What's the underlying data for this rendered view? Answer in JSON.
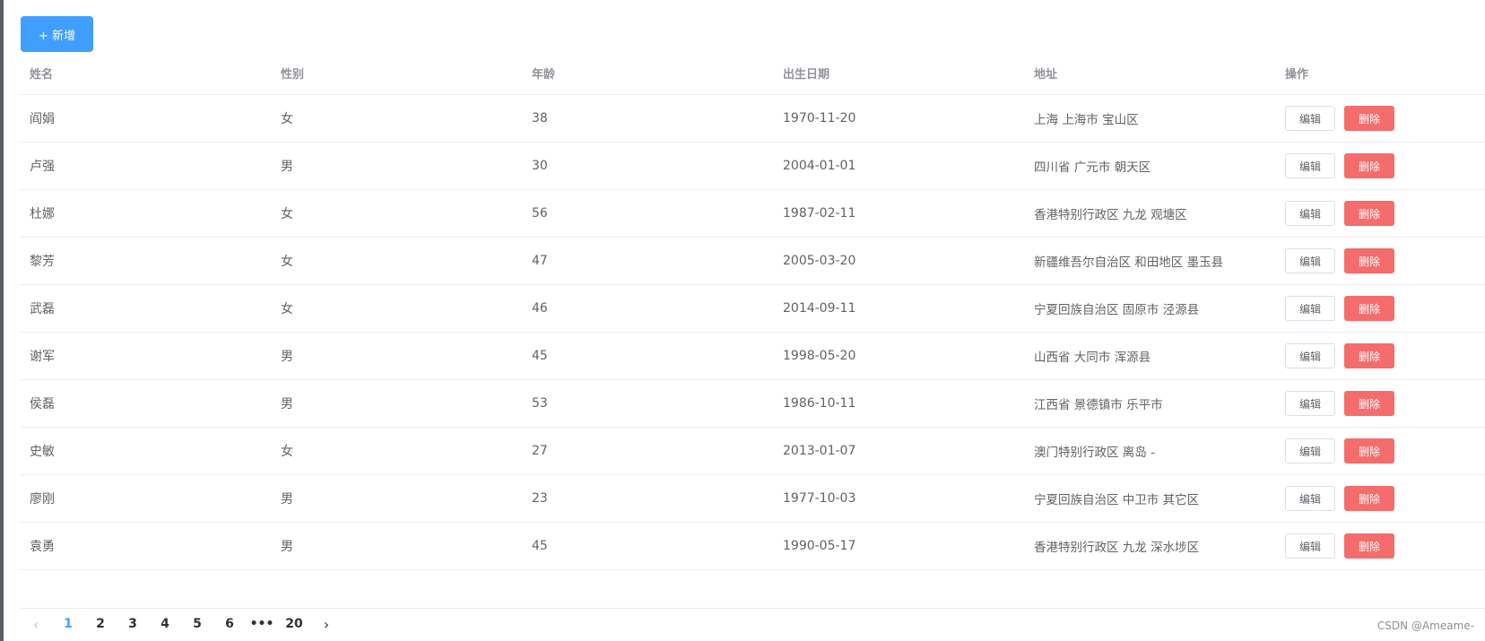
{
  "toolbar": {
    "add_label": "+ 新增"
  },
  "table": {
    "headers": [
      "姓名",
      "性别",
      "年龄",
      "出生日期",
      "地址",
      "操作"
    ],
    "edit_label": "编辑",
    "delete_label": "删除",
    "rows": [
      {
        "name": "阎娟",
        "gender": "女",
        "age": "38",
        "birth": "1970-11-20",
        "address": "上海 上海市 宝山区"
      },
      {
        "name": "卢强",
        "gender": "男",
        "age": "30",
        "birth": "2004-01-01",
        "address": "四川省 广元市 朝天区"
      },
      {
        "name": "杜娜",
        "gender": "女",
        "age": "56",
        "birth": "1987-02-11",
        "address": "香港特别行政区 九龙 观塘区"
      },
      {
        "name": "黎芳",
        "gender": "女",
        "age": "47",
        "birth": "2005-03-20",
        "address": "新疆维吾尔自治区 和田地区 墨玉县"
      },
      {
        "name": "武磊",
        "gender": "女",
        "age": "46",
        "birth": "2014-09-11",
        "address": "宁夏回族自治区 固原市 泾源县"
      },
      {
        "name": "谢军",
        "gender": "男",
        "age": "45",
        "birth": "1998-05-20",
        "address": "山西省 大同市 浑源县"
      },
      {
        "name": "侯磊",
        "gender": "男",
        "age": "53",
        "birth": "1986-10-11",
        "address": "江西省 景德镇市 乐平市"
      },
      {
        "name": "史敏",
        "gender": "女",
        "age": "27",
        "birth": "2013-01-07",
        "address": "澳门特别行政区 离岛 -"
      },
      {
        "name": "廖刚",
        "gender": "男",
        "age": "23",
        "birth": "1977-10-03",
        "address": "宁夏回族自治区 中卫市 其它区"
      },
      {
        "name": "袁勇",
        "gender": "男",
        "age": "45",
        "birth": "1990-05-17",
        "address": "香港特别行政区 九龙 深水埗区"
      }
    ]
  },
  "pagination": {
    "prev_icon": "‹",
    "next_icon": "›",
    "pages": [
      "1",
      "2",
      "3",
      "4",
      "5",
      "6"
    ],
    "ellipsis": "•••",
    "last_page": "20",
    "current": "1"
  },
  "watermark": "CSDN @Ameame-",
  "colors": {
    "primary": "#409eff",
    "danger": "#f56c6c",
    "border": "#ebeef5",
    "header_text": "#909399"
  }
}
